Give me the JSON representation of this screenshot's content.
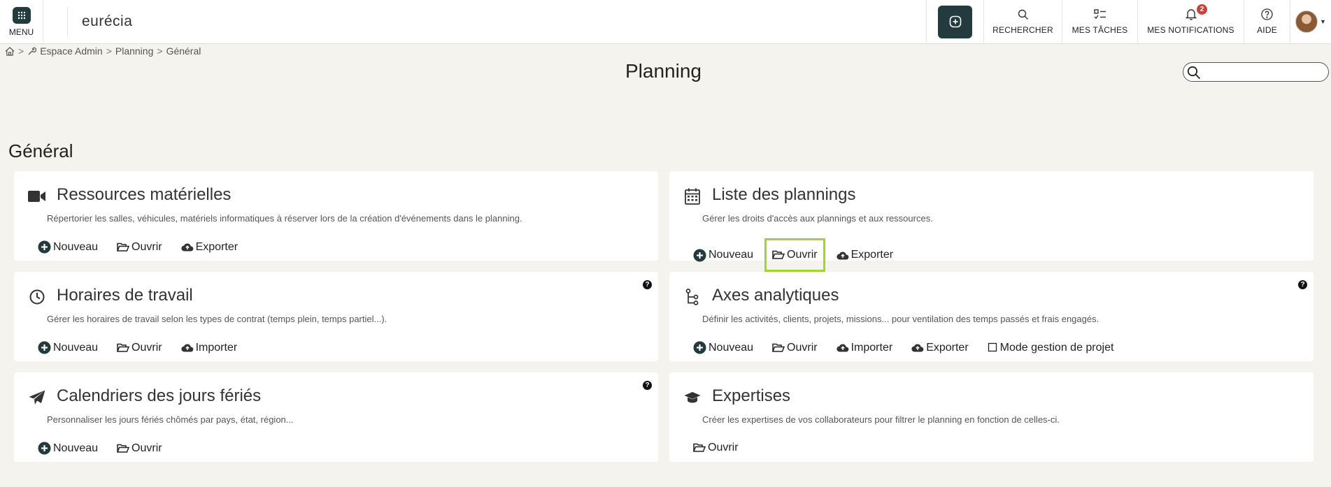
{
  "topbar": {
    "menu_label": "MENU",
    "brand": "eurécia",
    "search_label": "RECHERCHER",
    "tasks_label": "MES TÂCHES",
    "notifications_label": "MES NOTIFICATIONS",
    "notifications_count": "2",
    "help_label": "AIDE"
  },
  "breadcrumb": {
    "sep1": ">",
    "admin": "Espace Admin",
    "sep2": ">",
    "planning": "Planning",
    "sep3": ">",
    "general": "Général"
  },
  "page_title": "Planning",
  "search": {
    "placeholder": "",
    "value": ""
  },
  "section_title": "Général",
  "cards": [
    {
      "title": "Ressources matérielles",
      "icon": "video-camera-icon",
      "description": "Répertorier les salles, véhicules, matériels informatiques à réserver lors de la création d'événements dans le planning.",
      "actions": [
        "Nouveau",
        "Ouvrir",
        "Exporter"
      ]
    },
    {
      "title": "Liste des plannings",
      "icon": "calendar-icon",
      "description": "Gérer les droits d'accès aux plannings et aux ressources.",
      "actions": [
        "Nouveau",
        "Ouvrir",
        "Exporter"
      ]
    },
    {
      "title": "Horaires de travail",
      "icon": "clock-icon",
      "description": "Gérer les horaires de travail selon les types de contrat (temps plein, temps partiel...).",
      "actions": [
        "Nouveau",
        "Ouvrir",
        "Importer"
      ]
    },
    {
      "title": "Axes analytiques",
      "icon": "hierarchy-icon",
      "description": "Définir les activités, clients, projets, missions... pour ventilation des temps passés et frais engagés.",
      "actions": [
        "Nouveau",
        "Ouvrir",
        "Importer",
        "Exporter",
        "Mode gestion de projet"
      ]
    },
    {
      "title": "Calendriers des jours fériés",
      "icon": "paper-plane-icon",
      "description": "Personnaliser les jours fériés chômés par pays, état, région...",
      "actions": [
        "Nouveau",
        "Ouvrir"
      ]
    },
    {
      "title": "Expertises",
      "icon": "graduation-cap-icon",
      "description": "Créer les expertises de vos collaborateurs pour filtrer le planning en fonction de celles-ci.",
      "actions": [
        "Ouvrir"
      ]
    }
  ],
  "help_mark": "?",
  "colors": {
    "dark_teal": "#233b3e",
    "highlight": "#9fd62b",
    "badge": "#c8443a",
    "background": "#f5f3ee"
  }
}
